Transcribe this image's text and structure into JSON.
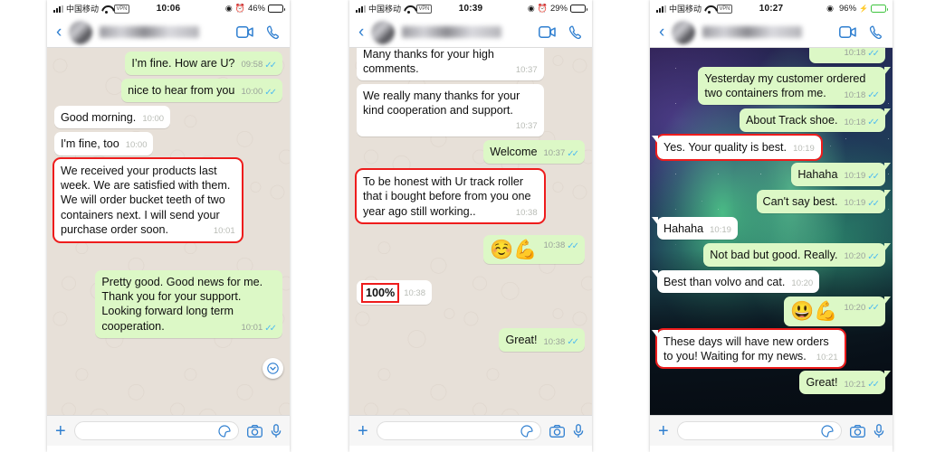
{
  "app": {
    "name": "WhatsApp",
    "platform": "iOS"
  },
  "colors": {
    "outgoing_bubble": "#dcf8c6",
    "incoming_bubble": "#ffffff",
    "accent_blue": "#2f7fd0",
    "tick_blue": "#4fbbf0",
    "highlight_red": "#ee1c1c",
    "doodle_background": "#e7e0d8",
    "battery_charging_green": "#3ec43e"
  },
  "icons": {
    "back": "‹",
    "video_call": "video-call-icon",
    "voice_call": "phone-icon",
    "plus": "+",
    "sticker": "sticker-icon",
    "camera": "camera-icon",
    "microphone": "microphone-icon",
    "scroll_down": "chevron-down-icon",
    "ticks": "✓✓",
    "location": "◉",
    "alarm": "⏰",
    "bolt": "⚡"
  },
  "phones": [
    {
      "id": "phone-1",
      "status_bar": {
        "carrier": "中国移动",
        "vpn": "VPN",
        "time": "10:06",
        "battery_percent": "46%",
        "battery_level": 46,
        "charging": false,
        "location_icon": "◉",
        "alarm_icon": "⏰"
      },
      "nav": {
        "contact_name": "",
        "contact_name_blurred": true
      },
      "wallpaper": "doodle",
      "bubble_style": "rounded",
      "scroll_down_button": true,
      "messages": [
        {
          "side": "me",
          "text": "I’m fine. How are U?",
          "time": "09:58",
          "ticks": true,
          "highlight": false
        },
        {
          "side": "me",
          "text": "nice to hear from you",
          "time": "10:00",
          "ticks": true,
          "highlight": false
        },
        {
          "side": "them",
          "text": "Good morning.",
          "time": "10:00",
          "ticks": false,
          "highlight": false
        },
        {
          "side": "them",
          "text": "I'm fine, too",
          "time": "10:00",
          "ticks": false,
          "highlight": false
        },
        {
          "side": "them",
          "text": "We received your products last week. We are satisfied with them. We will order bucket teeth of two containers next. I will send your purchase order soon.",
          "time": "10:01",
          "ticks": false,
          "highlight": true
        },
        {
          "side": "me",
          "text": "Pretty good. Good news for me. Thank you for your support. Looking forward long term cooperation.",
          "time": "10:01",
          "ticks": true,
          "highlight": false
        }
      ],
      "composer": {
        "value": "",
        "placeholder": ""
      }
    },
    {
      "id": "phone-2",
      "status_bar": {
        "carrier": "中国移动",
        "vpn": "VPN",
        "time": "10:39",
        "battery_percent": "29%",
        "battery_level": 29,
        "charging": false,
        "location_icon": "◉",
        "alarm_icon": "⏰"
      },
      "nav": {
        "contact_name": "",
        "contact_name_blurred": true
      },
      "wallpaper": "doodle",
      "bubble_style": "rounded",
      "scroll_down_button": false,
      "messages": [
        {
          "side": "them",
          "text": "Many thanks for your high comments.",
          "time": "10:37",
          "ticks": false,
          "highlight": false,
          "clipped": true
        },
        {
          "side": "them",
          "text": "We really many thanks for your kind cooperation and support.",
          "time": "10:37",
          "ticks": false,
          "highlight": false
        },
        {
          "side": "me",
          "text": "Welcome",
          "time": "10:37",
          "ticks": true,
          "highlight": false
        },
        {
          "side": "them",
          "text": "To be honest with Ur track roller that i bought before from you one year ago still working..",
          "time": "10:38",
          "ticks": false,
          "highlight": true
        },
        {
          "side": "me",
          "text": "☺️💪",
          "time": "10:38",
          "ticks": true,
          "highlight": false,
          "emoji": true
        },
        {
          "side": "them",
          "text": "100%",
          "time": "10:38",
          "ticks": false,
          "highlight": true,
          "highlight_text_only": true
        },
        {
          "side": "me",
          "text": "Great!",
          "time": "10:38",
          "ticks": true,
          "highlight": false
        }
      ],
      "composer": {
        "value": "",
        "placeholder": ""
      }
    },
    {
      "id": "phone-3",
      "status_bar": {
        "carrier": "中国移动",
        "vpn": "VPN",
        "time": "10:27",
        "battery_percent": "96%",
        "battery_level": 96,
        "charging": true,
        "location_icon": "◉",
        "alarm_icon": ""
      },
      "nav": {
        "contact_name": "",
        "contact_name_blurred": true
      },
      "wallpaper": "aurora",
      "bubble_style": "tailed",
      "scroll_down_button": false,
      "messages": [
        {
          "side": "me",
          "text": "",
          "time": "10:18",
          "ticks": true,
          "highlight": false,
          "clipped": true
        },
        {
          "side": "me",
          "text": "Yesterday my customer ordered two containers from me.",
          "time": "10:18",
          "ticks": true,
          "highlight": false
        },
        {
          "side": "me",
          "text": "About Track shoe.",
          "time": "10:18",
          "ticks": true,
          "highlight": false
        },
        {
          "side": "them",
          "text": "Yes. Your quality is best.",
          "time": "10:19",
          "ticks": false,
          "highlight": true
        },
        {
          "side": "me",
          "text": "Hahaha",
          "time": "10:19",
          "ticks": true,
          "highlight": false
        },
        {
          "side": "me",
          "text": "Can't say best.",
          "time": "10:19",
          "ticks": true,
          "highlight": false
        },
        {
          "side": "them",
          "text": "Hahaha",
          "time": "10:19",
          "ticks": false,
          "highlight": false
        },
        {
          "side": "me",
          "text": "Not bad but good. Really.",
          "time": "10:20",
          "ticks": true,
          "highlight": false
        },
        {
          "side": "them",
          "text": "Best than volvo and cat.",
          "time": "10:20",
          "ticks": false,
          "highlight": false
        },
        {
          "side": "me",
          "text": "😃💪",
          "time": "10:20",
          "ticks": true,
          "highlight": false,
          "emoji": true
        },
        {
          "side": "them",
          "text": "These days will have new orders to you! Waiting for my news.",
          "time": "10:21",
          "ticks": false,
          "highlight": true
        },
        {
          "side": "me",
          "text": "Great!",
          "time": "10:21",
          "ticks": true,
          "highlight": false
        }
      ],
      "composer": {
        "value": "",
        "placeholder": ""
      }
    }
  ]
}
